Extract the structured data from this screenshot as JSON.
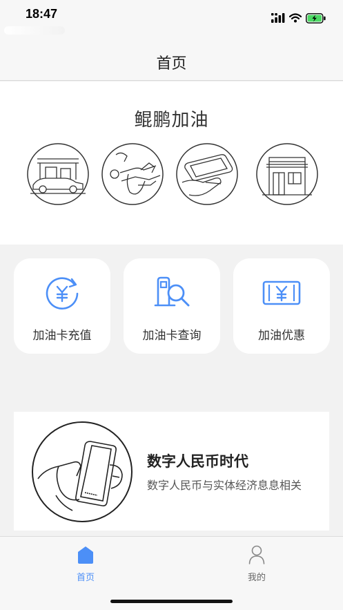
{
  "status_bar": {
    "time": "18:47",
    "icons": [
      "cellular-signal-icon",
      "wifi-icon",
      "battery-charging-icon"
    ]
  },
  "nav": {
    "title": "首页"
  },
  "hero": {
    "title": "鲲鹏加油",
    "illustrations": [
      "gas-station-car-icon",
      "fuel-nozzle-hand-icon",
      "phone-in-hand-icon",
      "storefront-icon"
    ]
  },
  "services": [
    {
      "label": "加油卡充值",
      "icon": "yuan-recharge-icon"
    },
    {
      "label": "加油卡查询",
      "icon": "fuel-pump-search-icon"
    },
    {
      "label": "加油优惠",
      "icon": "yuan-ticket-icon"
    }
  ],
  "banner": {
    "title": "数字人民币时代",
    "subtitle": "数字人民币与实体经济息息相关"
  },
  "tabs": [
    {
      "label": "首页",
      "icon": "home-icon",
      "active": true
    },
    {
      "label": "我的",
      "icon": "person-icon",
      "active": false
    }
  ],
  "colors": {
    "accent": "#4c8ff7",
    "inactive": "#888888",
    "background": "#f2f2f2",
    "card": "#ffffff"
  }
}
